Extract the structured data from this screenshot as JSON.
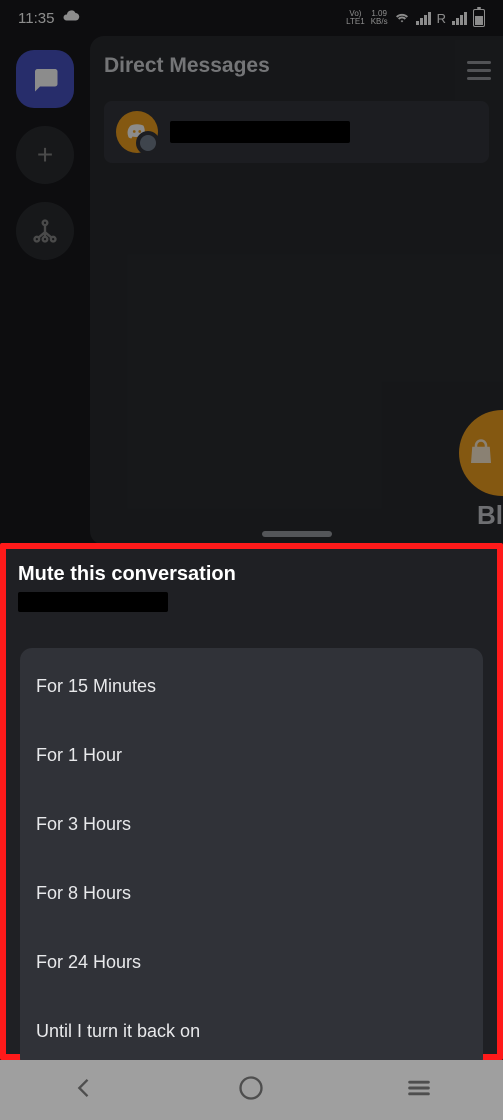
{
  "status_bar": {
    "time": "11:35",
    "lte_top": "Vo)",
    "lte_bottom": "LTE1",
    "kb_top": "1.09",
    "kb_bottom": "KB/s",
    "roaming": "R"
  },
  "panel": {
    "title": "Direct Messages"
  },
  "peek": {
    "text": "Bl"
  },
  "sheet": {
    "title": "Mute this conversation",
    "options": [
      "For 15 Minutes",
      "For 1 Hour",
      "For 3 Hours",
      "For 8 Hours",
      "For 24 Hours",
      "Until I turn it back on"
    ]
  }
}
